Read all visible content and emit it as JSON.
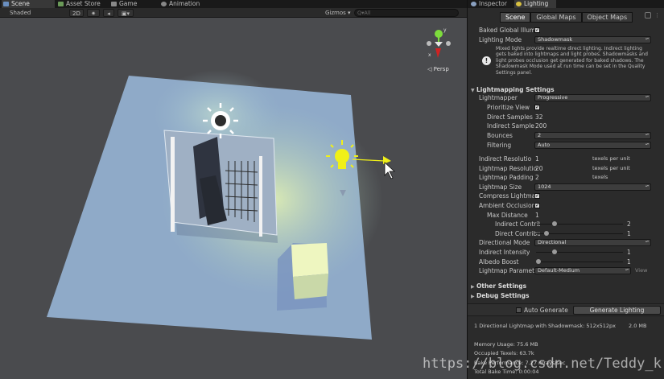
{
  "tabs": {
    "scene": "Scene",
    "asset_store": "Asset Store",
    "game": "Game",
    "animation": "Animation",
    "inspector": "Inspector",
    "lighting": "Lighting"
  },
  "scene_toolbar": {
    "shading_mode": "Shaded",
    "view_2d": "2D",
    "gizmos": "Gizmos ▾",
    "search_placeholder": "Q▾All"
  },
  "scene_view": {
    "projection": "◁ Persp",
    "gizmo_axes": {
      "y": "y",
      "x": "x"
    }
  },
  "lighting": {
    "mode_tabs": [
      "Scene",
      "Global Maps",
      "Object Maps"
    ],
    "baked_gi_label": "Baked Global Illum",
    "lighting_mode_label": "Lighting Mode",
    "lighting_mode_value": "Shadowmask",
    "info_text": "Mixed lights provide realtime direct lighting. Indirect lighting gets baked into lightmaps and light probes. Shadowmasks and light probes occlusion get generated for baked shadows. The Shadowmask Mode used at run time can be set in the Quality Settings panel.",
    "section_lightmapping": "Lightmapping Settings",
    "lightmapper_label": "Lightmapper",
    "lightmapper_value": "Progressive",
    "prioritize_view_label": "Prioritize View",
    "direct_samples_label": "Direct Samples",
    "direct_samples_value": "32",
    "indirect_samples_label": "Indirect Sample",
    "indirect_samples_value": "200",
    "bounces_label": "Bounces",
    "bounces_value": "2",
    "filtering_label": "Filtering",
    "filtering_value": "Auto",
    "indirect_resolution_label": "Indirect Resolutio",
    "indirect_resolution_value": "1",
    "indirect_resolution_unit": "texels per unit",
    "lightmap_resolution_label": "Lightmap Resolutio",
    "lightmap_resolution_value": "20",
    "lightmap_resolution_unit": "texels per unit",
    "lightmap_padding_label": "Lightmap Padding",
    "lightmap_padding_value": "2",
    "lightmap_padding_unit": "texels",
    "lightmap_size_label": "Lightmap Size",
    "lightmap_size_value": "1024",
    "compress_label": "Compress Lightma",
    "ambient_occlusion_label": "Ambient Occlusion",
    "max_distance_label": "Max Distance",
    "max_distance_value": "1",
    "indirect_contrib_label": "Indirect Contrib",
    "indirect_contrib_value": "2",
    "indirect_contrib_fraction": 0.2,
    "direct_contrib_label": "Direct Contribut",
    "direct_contrib_value": "1",
    "direct_contrib_fraction": 0.1,
    "directional_mode_label": "Directional Mode",
    "directional_mode_value": "Directional",
    "indirect_intensity_label": "Indirect Intensity",
    "indirect_intensity_value": "1",
    "indirect_intensity_fraction": 0.2,
    "albedo_boost_label": "Albedo Boost",
    "albedo_boost_value": "1",
    "albedo_boost_fraction": 0.0,
    "lightmap_params_label": "Lightmap Paramet",
    "lightmap_params_value": "Default-Medium",
    "lightmap_params_view": "View",
    "section_other": "Other Settings",
    "section_debug": "Debug Settings",
    "auto_generate_label": "Auto Generate",
    "generate_button": "Generate Lighting",
    "lightmap_summary": "1 Directional Lightmap with Shadowmask: 512x512px",
    "lightmap_size_total": "2.0 MB",
    "memory_usage": "Memory Usage: 75.6 MB",
    "occupied_texels": "Occupied Texels: 63.7k",
    "bake_performance": "Bake Performance: 7.27 mrays/sec",
    "total_bake_time": "Total Bake Time: 0:00:04"
  },
  "watermark": "https://blog.csdn.net/Teddy_k",
  "colors": {
    "panel_bg": "#2b2b2b",
    "scene_bg": "#4a4b4e",
    "light_yellow": "#f0f018",
    "gizmo_green": "#7ddc3c",
    "gizmo_red": "#d02222"
  }
}
